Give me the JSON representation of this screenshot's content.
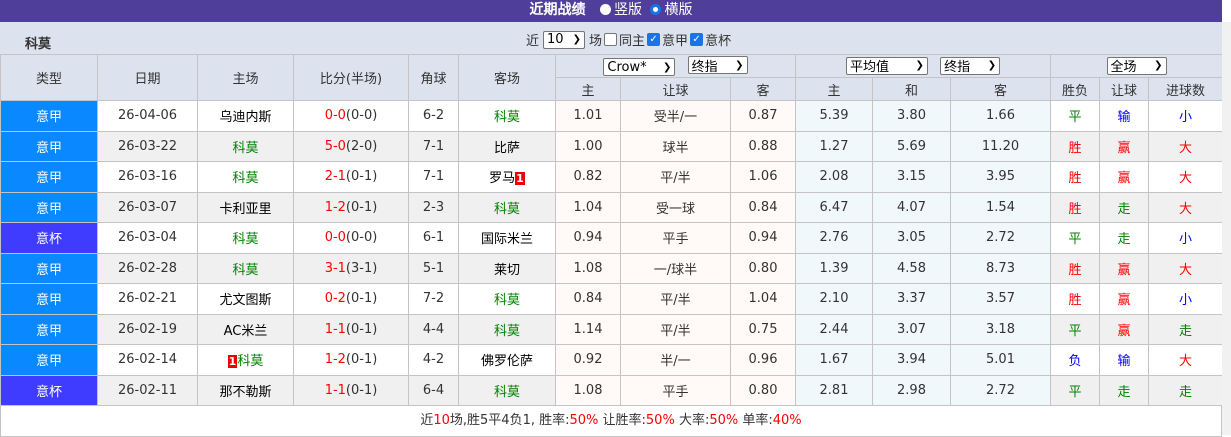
{
  "title": "近期战绩",
  "layout_options": [
    {
      "label": "竖版",
      "selected": false
    },
    {
      "label": "横版",
      "selected": true
    }
  ],
  "team": "科莫",
  "filters": {
    "prefix": "近",
    "count": "10",
    "suffix": "场",
    "same_home": {
      "label": "同主",
      "checked": false
    },
    "league1": {
      "label": "意甲",
      "checked": true
    },
    "league2": {
      "label": "意杯",
      "checked": true
    }
  },
  "headers": {
    "type": "类型",
    "date": "日期",
    "home": "主场",
    "score": "比分(半场)",
    "corner": "角球",
    "away": "客场",
    "company_select": "Crow*",
    "asian_select": "终指",
    "avg_select": "平均值",
    "euro_select": "终指",
    "scope_select": "全场",
    "ah_home": "主",
    "ah_line": "让球",
    "ah_away": "客",
    "eu_home": "主",
    "eu_draw": "和",
    "eu_away": "客",
    "res": "胜负",
    "handicap": "让球",
    "goals": "进球数"
  },
  "colors": {
    "serie_a": "#0a88ff",
    "coppa": "#3f3cff",
    "title_bar": "#4f3f9b",
    "highlight_team": "#008000",
    "score": "#ff0000"
  },
  "rows": [
    {
      "type": "意甲",
      "date": "26-04-06",
      "home": "乌迪内斯",
      "home_hl": false,
      "home_card": "",
      "ft": "0-0",
      "ht": "(0-0)",
      "corner": "6-2",
      "away": "科莫",
      "away_hl": true,
      "away_card": "",
      "ah": [
        "1.01",
        "受半/一",
        "0.87"
      ],
      "eu": [
        "5.39",
        "3.80",
        "1.66"
      ],
      "res": "平",
      "hc": "输",
      "goals": "小"
    },
    {
      "type": "意甲",
      "date": "26-03-22",
      "home": "科莫",
      "home_hl": true,
      "home_card": "",
      "ft": "5-0",
      "ht": "(2-0)",
      "corner": "7-1",
      "away": "比萨",
      "away_hl": false,
      "away_card": "",
      "ah": [
        "1.00",
        "球半",
        "0.88"
      ],
      "eu": [
        "1.27",
        "5.69",
        "11.20"
      ],
      "res": "胜",
      "hc": "赢",
      "goals": "大"
    },
    {
      "type": "意甲",
      "date": "26-03-16",
      "home": "科莫",
      "home_hl": true,
      "home_card": "",
      "ft": "2-1",
      "ht": "(0-1)",
      "corner": "7-1",
      "away": "罗马",
      "away_hl": false,
      "away_card": "1",
      "ah": [
        "0.82",
        "平/半",
        "1.06"
      ],
      "eu": [
        "2.08",
        "3.15",
        "3.95"
      ],
      "res": "胜",
      "hc": "赢",
      "goals": "大"
    },
    {
      "type": "意甲",
      "date": "26-03-07",
      "home": "卡利亚里",
      "home_hl": false,
      "home_card": "",
      "ft": "1-2",
      "ht": "(0-1)",
      "corner": "2-3",
      "away": "科莫",
      "away_hl": true,
      "away_card": "",
      "ah": [
        "1.04",
        "受一球",
        "0.84"
      ],
      "eu": [
        "6.47",
        "4.07",
        "1.54"
      ],
      "res": "胜",
      "hc": "走",
      "goals": "大"
    },
    {
      "type": "意杯",
      "date": "26-03-04",
      "home": "科莫",
      "home_hl": true,
      "home_card": "",
      "ft": "0-0",
      "ht": "(0-0)",
      "corner": "6-1",
      "away": "国际米兰",
      "away_hl": false,
      "away_card": "",
      "ah": [
        "0.94",
        "平手",
        "0.94"
      ],
      "eu": [
        "2.76",
        "3.05",
        "2.72"
      ],
      "res": "平",
      "hc": "走",
      "goals": "小"
    },
    {
      "type": "意甲",
      "date": "26-02-28",
      "home": "科莫",
      "home_hl": true,
      "home_card": "",
      "ft": "3-1",
      "ht": "(3-1)",
      "corner": "5-1",
      "away": "莱切",
      "away_hl": false,
      "away_card": "",
      "ah": [
        "1.08",
        "一/球半",
        "0.80"
      ],
      "eu": [
        "1.39",
        "4.58",
        "8.73"
      ],
      "res": "胜",
      "hc": "赢",
      "goals": "大"
    },
    {
      "type": "意甲",
      "date": "26-02-21",
      "home": "尤文图斯",
      "home_hl": false,
      "home_card": "",
      "ft": "0-2",
      "ht": "(0-1)",
      "corner": "7-2",
      "away": "科莫",
      "away_hl": true,
      "away_card": "",
      "ah": [
        "0.84",
        "平/半",
        "1.04"
      ],
      "eu": [
        "2.10",
        "3.37",
        "3.57"
      ],
      "res": "胜",
      "hc": "赢",
      "goals": "小"
    },
    {
      "type": "意甲",
      "date": "26-02-19",
      "home": "AC米兰",
      "home_hl": false,
      "home_card": "",
      "ft": "1-1",
      "ht": "(0-1)",
      "corner": "4-4",
      "away": "科莫",
      "away_hl": true,
      "away_card": "",
      "ah": [
        "1.14",
        "平/半",
        "0.75"
      ],
      "eu": [
        "2.44",
        "3.07",
        "3.18"
      ],
      "res": "平",
      "hc": "赢",
      "goals": "走"
    },
    {
      "type": "意甲",
      "date": "26-02-14",
      "home": "科莫",
      "home_hl": true,
      "home_card": "1",
      "ft": "1-2",
      "ht": "(0-1)",
      "corner": "4-2",
      "away": "佛罗伦萨",
      "away_hl": false,
      "away_card": "",
      "ah": [
        "0.92",
        "半/一",
        "0.96"
      ],
      "eu": [
        "1.67",
        "3.94",
        "5.01"
      ],
      "res": "负",
      "hc": "输",
      "goals": "大"
    },
    {
      "type": "意杯",
      "date": "26-02-11",
      "home": "那不勒斯",
      "home_hl": false,
      "home_card": "",
      "ft": "1-1",
      "ht": "(0-1)",
      "corner": "6-4",
      "away": "科莫",
      "away_hl": true,
      "away_card": "",
      "ah": [
        "1.08",
        "平手",
        "0.80"
      ],
      "eu": [
        "2.81",
        "2.98",
        "2.72"
      ],
      "res": "平",
      "hc": "走",
      "goals": "走"
    }
  ],
  "summary": {
    "p1": "近",
    "n": "10",
    "p2": "场,胜5平4负1, 胜率:",
    "win": "50%",
    "p3": " 让胜率:",
    "hwin": "50%",
    "p4": " 大率:",
    "big": "50%",
    "p5": " 单率:",
    "odd": "40%"
  }
}
